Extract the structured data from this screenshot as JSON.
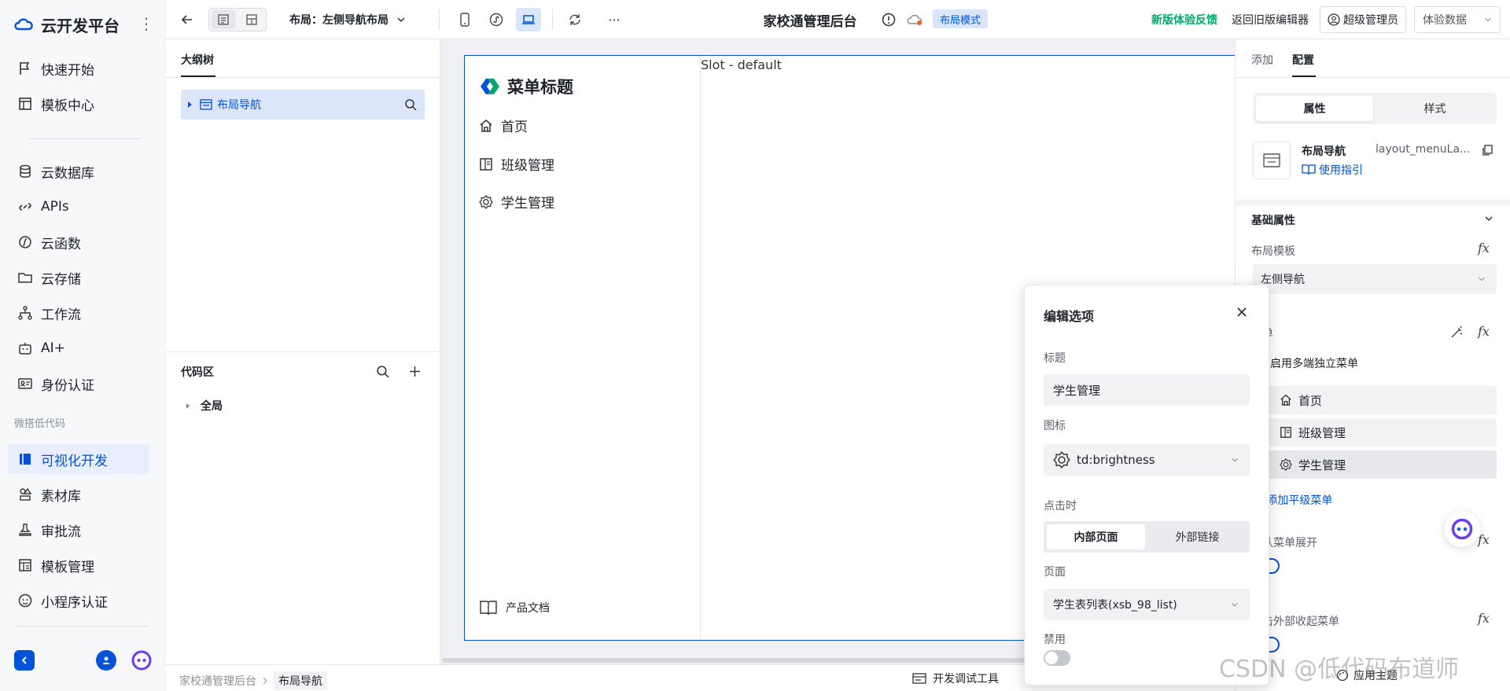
{
  "app": {
    "title": "云开发平台",
    "more": "⋮"
  },
  "nav": {
    "top": [
      {
        "label": "快速开始",
        "icon": "flag-icon"
      },
      {
        "label": "模板中心",
        "icon": "template-icon"
      }
    ],
    "main": [
      {
        "label": "云数据库",
        "icon": "database-icon"
      },
      {
        "label": "APIs",
        "icon": "link-icon"
      },
      {
        "label": "云函数",
        "icon": "function-icon"
      },
      {
        "label": "云存储",
        "icon": "cloud-folder-icon"
      },
      {
        "label": "工作流",
        "icon": "workflow-icon"
      },
      {
        "label": "AI+",
        "icon": "robot-icon"
      },
      {
        "label": "身份认证",
        "icon": "id-card-icon"
      }
    ],
    "group_label": "微搭低代码",
    "lowcode": [
      {
        "label": "可视化开发",
        "icon": "visual-dev-icon",
        "active": true
      },
      {
        "label": "素材库",
        "icon": "shapes-icon"
      },
      {
        "label": "审批流",
        "icon": "stamp-icon"
      },
      {
        "label": "模板管理",
        "icon": "template-manage-icon"
      },
      {
        "label": "小程序认证",
        "icon": "mini-program-icon"
      }
    ]
  },
  "topbar": {
    "layout_label": "布局：左侧导航布局",
    "page_title": "家校通管理后台",
    "mode_badge": "布局模式",
    "feedback": "新版体验反馈",
    "back_old": "返回旧版编辑器",
    "user": "超级管理员",
    "data_select": "体验数据",
    "more": "···"
  },
  "outline": {
    "tab": "大纲树",
    "tree_item": "布局导航",
    "code_title": "代码区",
    "code_item": "全局"
  },
  "canvas": {
    "menu_title": "菜单标题",
    "menu_items": [
      {
        "label": "首页",
        "icon": "home-icon"
      },
      {
        "label": "班级管理",
        "icon": "book-icon"
      },
      {
        "label": "学生管理",
        "icon": "brightness-icon"
      }
    ],
    "footer_link": "产品文档",
    "slot": "Slot - default"
  },
  "status": {
    "breadcrumb": [
      "家校通管理后台",
      "布局导航"
    ],
    "dev_tools": "开发调试工具"
  },
  "right": {
    "tabs": [
      "添加",
      "配置"
    ],
    "seg": [
      "属性",
      "样式"
    ],
    "component_name": "布局导航",
    "component_id": "layout_menuLa...",
    "guide": "使用指引",
    "section": "基础属性",
    "layout_template_label": "布局模板",
    "layout_template_value": "左侧导航",
    "menu_label": "菜单",
    "multi_menu": "启用多端独立菜单",
    "menu_rows": [
      {
        "label": "首页",
        "icon": "home-icon"
      },
      {
        "label": "班级管理",
        "icon": "book-icon"
      },
      {
        "label": "学生管理",
        "icon": "brightness-icon"
      }
    ],
    "add_menu": "添加平级菜单",
    "expand_label": "默认菜单展开",
    "collapse_label": "点击外部收起菜单",
    "theme": "应用主题",
    "fx": "fx"
  },
  "modal": {
    "title": "编辑选项",
    "title_label": "标题",
    "title_value": "学生管理",
    "icon_label": "图标",
    "icon_value": "td:brightness",
    "click_label": "点击时",
    "click_options": [
      "内部页面",
      "外部链接"
    ],
    "page_label": "页面",
    "page_value": "学生表列表(xsb_98_list)",
    "disabled_label": "禁用"
  },
  "watermark": "CSDN @低代码布道师",
  "colors": {
    "accent": "#0052d9",
    "success": "#00a870",
    "brand_purple": "#6b3cf6"
  }
}
